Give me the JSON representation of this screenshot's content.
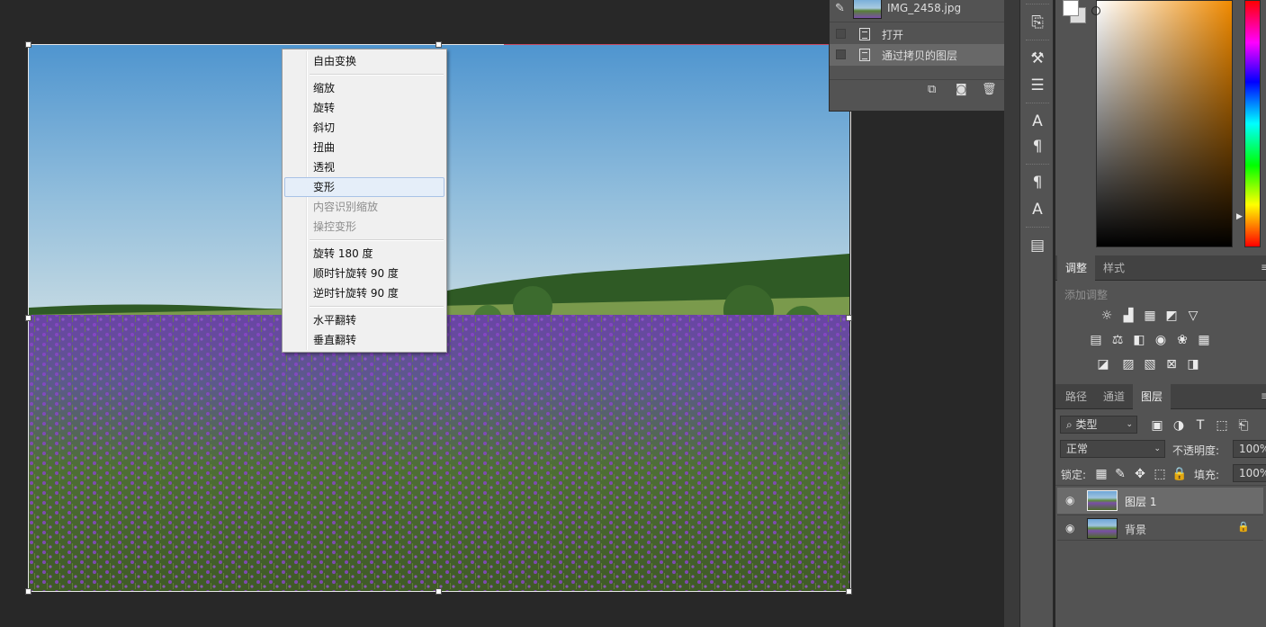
{
  "context_menu": {
    "items": [
      {
        "label": "自由变换",
        "state": "normal"
      },
      {
        "sep": true
      },
      {
        "label": "缩放",
        "state": "normal"
      },
      {
        "label": "旋转",
        "state": "normal"
      },
      {
        "label": "斜切",
        "state": "normal"
      },
      {
        "label": "扭曲",
        "state": "normal"
      },
      {
        "label": "透视",
        "state": "normal"
      },
      {
        "label": "变形",
        "state": "highlighted"
      },
      {
        "label": "内容识别缩放",
        "state": "disabled"
      },
      {
        "label": "操控变形",
        "state": "disabled"
      },
      {
        "sep": true
      },
      {
        "label": "旋转 180 度",
        "state": "normal"
      },
      {
        "label": "顺时针旋转 90 度",
        "state": "normal"
      },
      {
        "label": "逆时针旋转 90 度",
        "state": "normal"
      },
      {
        "sep": true
      },
      {
        "label": "水平翻转",
        "state": "normal"
      },
      {
        "label": "垂直翻转",
        "state": "normal"
      }
    ]
  },
  "history": {
    "snapshot": "IMG_2458.jpg",
    "steps": [
      "打开",
      "通过拷贝的图层"
    ]
  },
  "adjustments": {
    "tabs": [
      "调整",
      "样式"
    ],
    "active_tab": "调整",
    "add_label": "添加调整"
  },
  "layers": {
    "tabs": [
      "路径",
      "通道",
      "图层"
    ],
    "active_tab": "图层",
    "filter_kind": "类型",
    "blend_mode": "正常",
    "opacity_label": "不透明度:",
    "opacity_value": "100%",
    "lock_label": "锁定:",
    "fill_label": "填充:",
    "fill_value": "100%",
    "items": [
      {
        "name": "图层 1",
        "selected": true,
        "locked": false
      },
      {
        "name": "背景",
        "selected": false,
        "locked": true
      }
    ]
  },
  "colors": {
    "menu_highlight": "#e5eef9",
    "panel_bg": "#535353",
    "guide": "#c74a62"
  }
}
